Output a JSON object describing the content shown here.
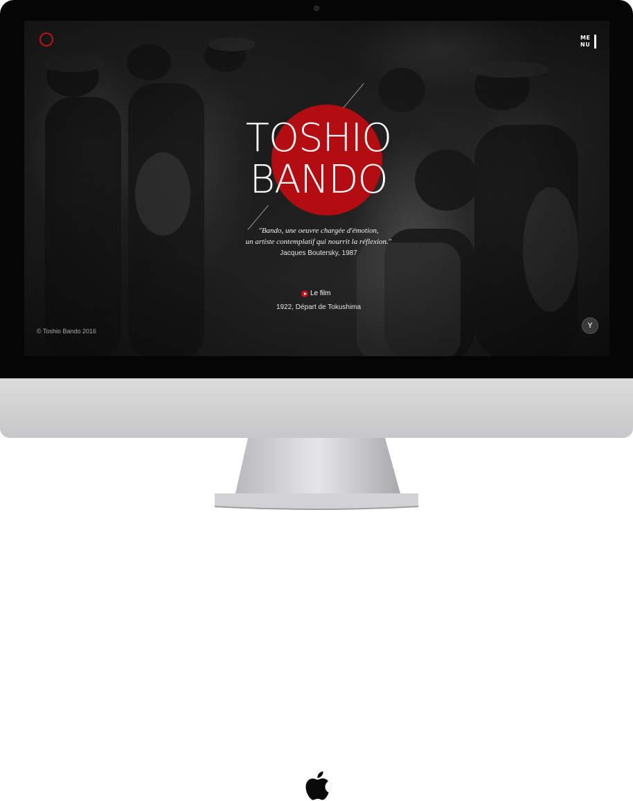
{
  "site": {
    "title_line1": "TOSHIO",
    "title_line2": "BANDO",
    "menu_label": "ME\nNU",
    "quote_line1": "\"Bando, une oeuvre chargée d'émotion,",
    "quote_line2": "un artiste contemplatif qui nourrit la réflexion.\"",
    "quote_author": "Jacques Boutersky, 1987",
    "film_link": "Le film",
    "film_subtitle": "1922, Départ de Tokushima",
    "copyright": "© Toshio Bando 2016",
    "corner_button": "Y"
  },
  "colors": {
    "accent_red": "#b30d11",
    "logo_red": "#c0101a",
    "text": "#ffffff"
  },
  "icons": {
    "logo": "red-circle-outline",
    "film": "play-circle-icon",
    "device": "apple-logo"
  }
}
